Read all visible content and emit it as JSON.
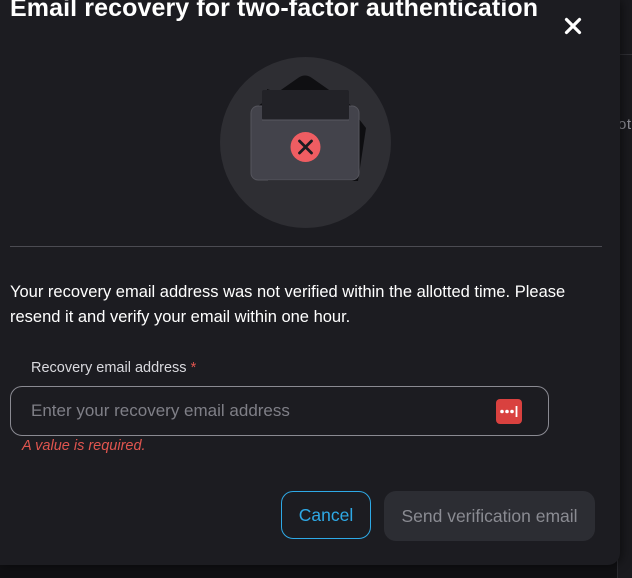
{
  "background": {
    "partial_text": "ot"
  },
  "dialog": {
    "title": "Email recovery for two-factor authentication",
    "close_icon": "close-icon",
    "illustration_icon": "envelope-error-icon",
    "message": "Your recovery email address was not verified within the allotted time. Please resend it and verify your email within one hour.",
    "field": {
      "label": "Recovery email address",
      "required_marker": "*",
      "placeholder": "Enter your recovery email address",
      "value": "",
      "trailing_icon": "password-manager-icon",
      "error": "A value is required."
    },
    "buttons": {
      "cancel_label": "Cancel",
      "send_label": "Send verification email"
    }
  },
  "colors": {
    "dialog_bg": "#1c1c21",
    "accent": "#2ea9e6",
    "error": "#e0554f",
    "disabled_button_bg": "#2c2d33"
  }
}
